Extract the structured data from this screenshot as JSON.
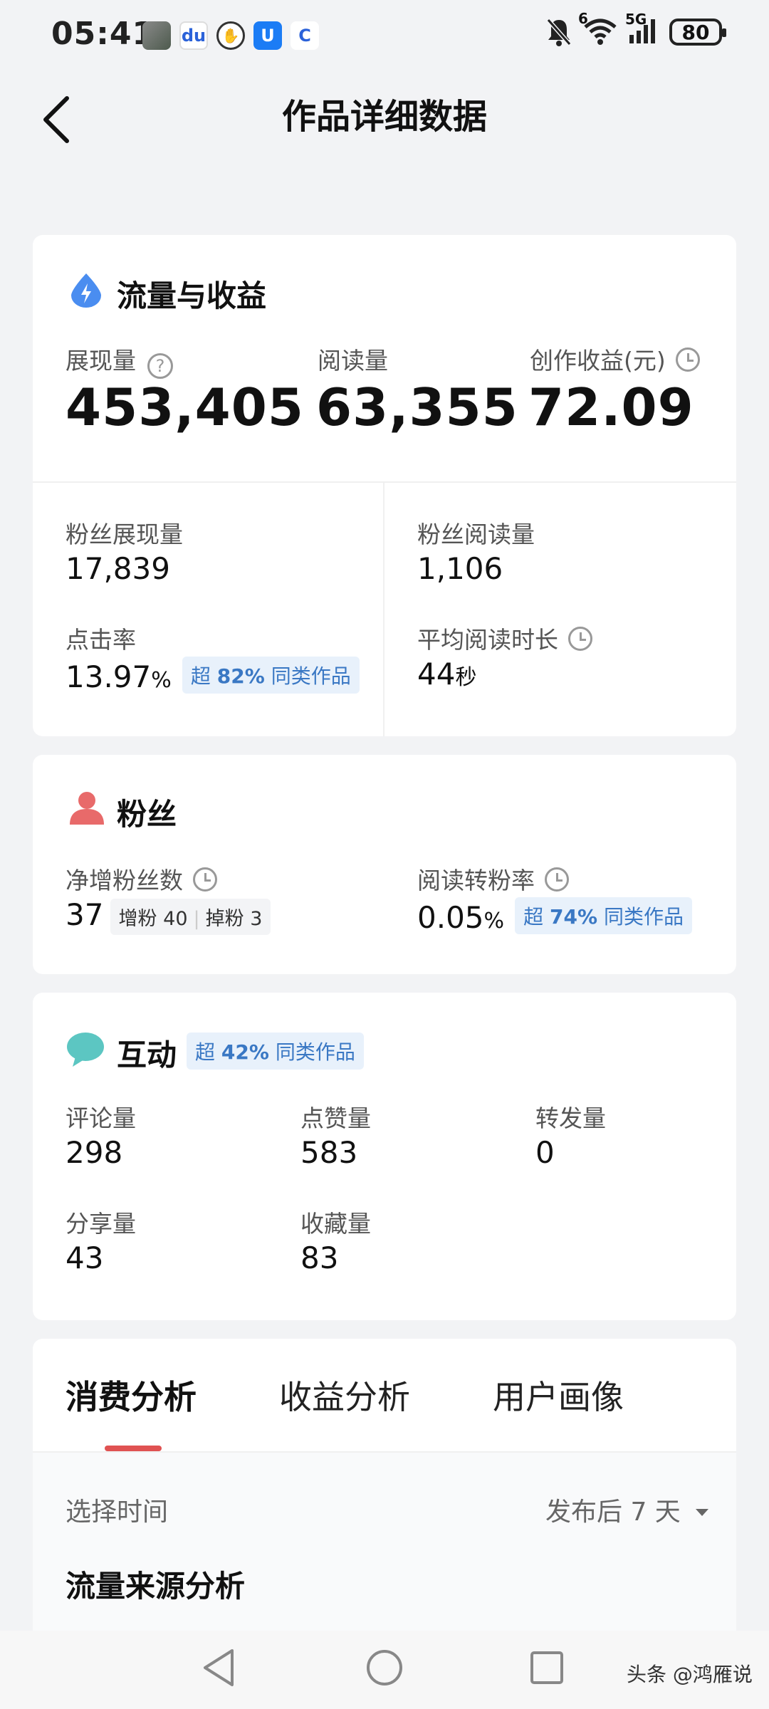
{
  "status_bar": {
    "time": "05:41",
    "battery": "80",
    "network": "5G",
    "wifi_superscript": "6",
    "icons": [
      "photo-thumbnail-icon",
      "baidu-icon",
      "hand-icon",
      "app-u-icon",
      "app-c-icon",
      "bell-muted-icon",
      "wifi-icon",
      "signal-icon",
      "battery-icon"
    ]
  },
  "nav": {
    "title": "作品详细数据"
  },
  "traffic": {
    "title": "流量与收益",
    "impressions_label": "展现量",
    "impressions_value": "453,405",
    "reads_label": "阅读量",
    "reads_value": "63,355",
    "income_label": "创作收益(元)",
    "income_value": "72.09",
    "fan_impressions_label": "粉丝展现量",
    "fan_impressions_value": "17,839",
    "fan_reads_label": "粉丝阅读量",
    "fan_reads_value": "1,106",
    "ctr_label": "点击率",
    "ctr_value": "13.97",
    "ctr_unit": "%",
    "ctr_badge_prefix": "超",
    "ctr_badge_pct": "82%",
    "ctr_badge_suffix": "同类作品",
    "avg_time_label": "平均阅读时长",
    "avg_time_value": "44",
    "avg_time_unit": "秒"
  },
  "fans": {
    "title": "粉丝",
    "net_label": "净增粉丝数",
    "net_value": "37",
    "gain_label": "增粉",
    "gain_value": "40",
    "lost_label": "掉粉",
    "lost_value": "3",
    "conv_label": "阅读转粉率",
    "conv_value": "0.05",
    "conv_unit": "%",
    "conv_badge_prefix": "超",
    "conv_badge_pct": "74%",
    "conv_badge_suffix": "同类作品"
  },
  "interaction": {
    "title": "互动",
    "badge_prefix": "超",
    "badge_pct": "42%",
    "badge_suffix": "同类作品",
    "comments_label": "评论量",
    "comments_value": "298",
    "likes_label": "点赞量",
    "likes_value": "583",
    "reposts_label": "转发量",
    "reposts_value": "0",
    "shares_label": "分享量",
    "shares_value": "43",
    "favorites_label": "收藏量",
    "favorites_value": "83"
  },
  "analysis": {
    "tabs": [
      "消费分析",
      "收益分析",
      "用户画像"
    ],
    "active_tab": 0,
    "select_time_label": "选择时间",
    "select_time_value": "发布后 7 天",
    "section_title": "流量来源分析"
  },
  "watermark": "头条 @鸿雁说",
  "colors": {
    "accent_red": "#e05252",
    "badge_blue": "#3a78c4",
    "icon_blue": "#4a8df0",
    "fans_icon": "#e86a6a",
    "chat_icon": "#5cc6c2"
  }
}
